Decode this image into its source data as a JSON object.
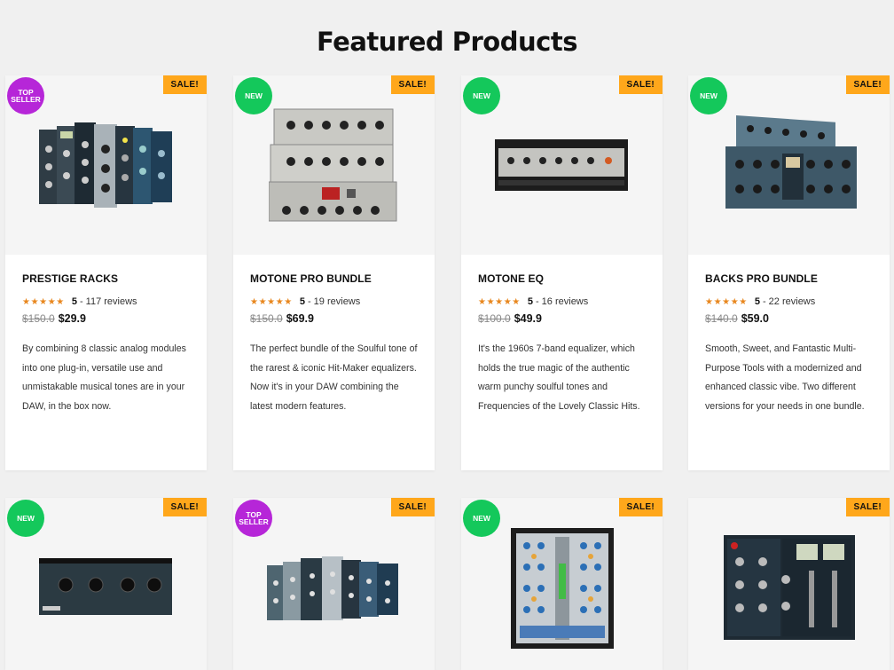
{
  "page": {
    "heading": "Featured Products"
  },
  "products": [
    {
      "badge_sale": "SALE!",
      "badge": "TOP SELLER",
      "badge_type": "top",
      "title": "PRESTIGE RACKS",
      "stars": "★★★★★",
      "rating": "5",
      "reviews": "- 117 reviews",
      "old_price": "$150.0",
      "price": "$29.9",
      "description": "By combining 8 classic analog modules into one plug-in, versatile use and unmistakable musical tones are in your DAW, in the box now."
    },
    {
      "badge_sale": "SALE!",
      "badge": "NEW",
      "badge_type": "new",
      "title": "MOTONE PRO BUNDLE",
      "stars": "★★★★★",
      "rating": "5",
      "reviews": "- 19 reviews",
      "old_price": "$150.0",
      "price": "$69.9",
      "description": "The perfect bundle of the Soulful tone of the rarest & iconic Hit-Maker equalizers. Now it's in your DAW combining the latest modern features."
    },
    {
      "badge_sale": "SALE!",
      "badge": "NEW",
      "badge_type": "new",
      "title": "MOTONE EQ",
      "stars": "★★★★★",
      "rating": "5",
      "reviews": "- 16 reviews",
      "old_price": "$100.0",
      "price": "$49.9",
      "description": "It's the 1960s 7-band equalizer, which holds the true magic of the authentic warm punchy soulful tones and Frequencies of the Lovely Classic Hits."
    },
    {
      "badge_sale": "SALE!",
      "badge": "NEW",
      "badge_type": "new",
      "title": "BACKS PRO BUNDLE",
      "stars": "★★★★★",
      "rating": "5",
      "reviews": "- 22 reviews",
      "old_price": "$140.0",
      "price": "$59.0",
      "description": "Smooth, Sweet, and Fantastic Multi-Purpose Tools with a modernized and enhanced classic vibe. Two different versions for your needs in one bundle."
    },
    {
      "badge_sale": "SALE!",
      "badge": "NEW",
      "badge_type": "new"
    },
    {
      "badge_sale": "SALE!",
      "badge": "TOP SELLER",
      "badge_type": "top"
    },
    {
      "badge_sale": "SALE!",
      "badge": "NEW",
      "badge_type": "new"
    },
    {
      "badge_sale": "SALE!"
    }
  ],
  "colors": {
    "sale": "#ffa71b",
    "new": "#14c85b",
    "top_seller": "#b626d8",
    "stars": "#e8871e"
  }
}
